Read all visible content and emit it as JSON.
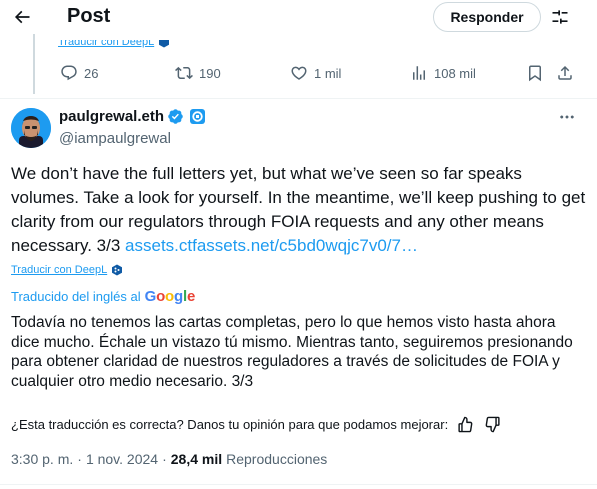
{
  "header": {
    "title": "Post",
    "reply_label": "Responder",
    "back_icon": "arrow-left-icon",
    "settings_icon": "sliders-icon"
  },
  "previous_post": {
    "translate_label": "Traducir con DeepL",
    "actions": {
      "replies": "26",
      "reposts": "190",
      "likes": "1 mil",
      "views": "108 mil"
    }
  },
  "post": {
    "author_name": "paulgrewal.eth",
    "author_handle": "@iampaulgrewal",
    "text": "We don’t have the full letters yet, but what we’ve seen so far speaks volumes. Take a look for yourself. In the meantime, we’ll keep pushing to get clarity from our regulators through FOIA requests and any other means necessary. 3/3 ",
    "link": "assets.ctfassets.net/c5bd0wqjc7v0/7…",
    "translate_deepl_label": "Traducir con DeepL",
    "translated_from_label": "Traducido del inglés al",
    "google_label": "Google",
    "translated_text": "Todavía no tenemos las cartas completas, pero lo que hemos visto hasta ahora dice mucho. Échale un vistazo tú mismo. Mientras tanto, seguiremos presionando para obtener claridad de nuestros reguladores a través de solicitudes de FOIA y cualquier otro medio necesario. 3/3",
    "feedback_question": "¿Esta traducción es correcta? Danos tu opinión para que podamos mejorar:",
    "time": "3:30 p. m.",
    "date": "1 nov. 2024",
    "separator": "·",
    "view_count": "28,4 mil",
    "views_label": "Reproducciones"
  },
  "colors": {
    "accent": "#1d9bf0",
    "text": "#0f1419",
    "secondary": "#536471",
    "border": "#cfd9de"
  }
}
